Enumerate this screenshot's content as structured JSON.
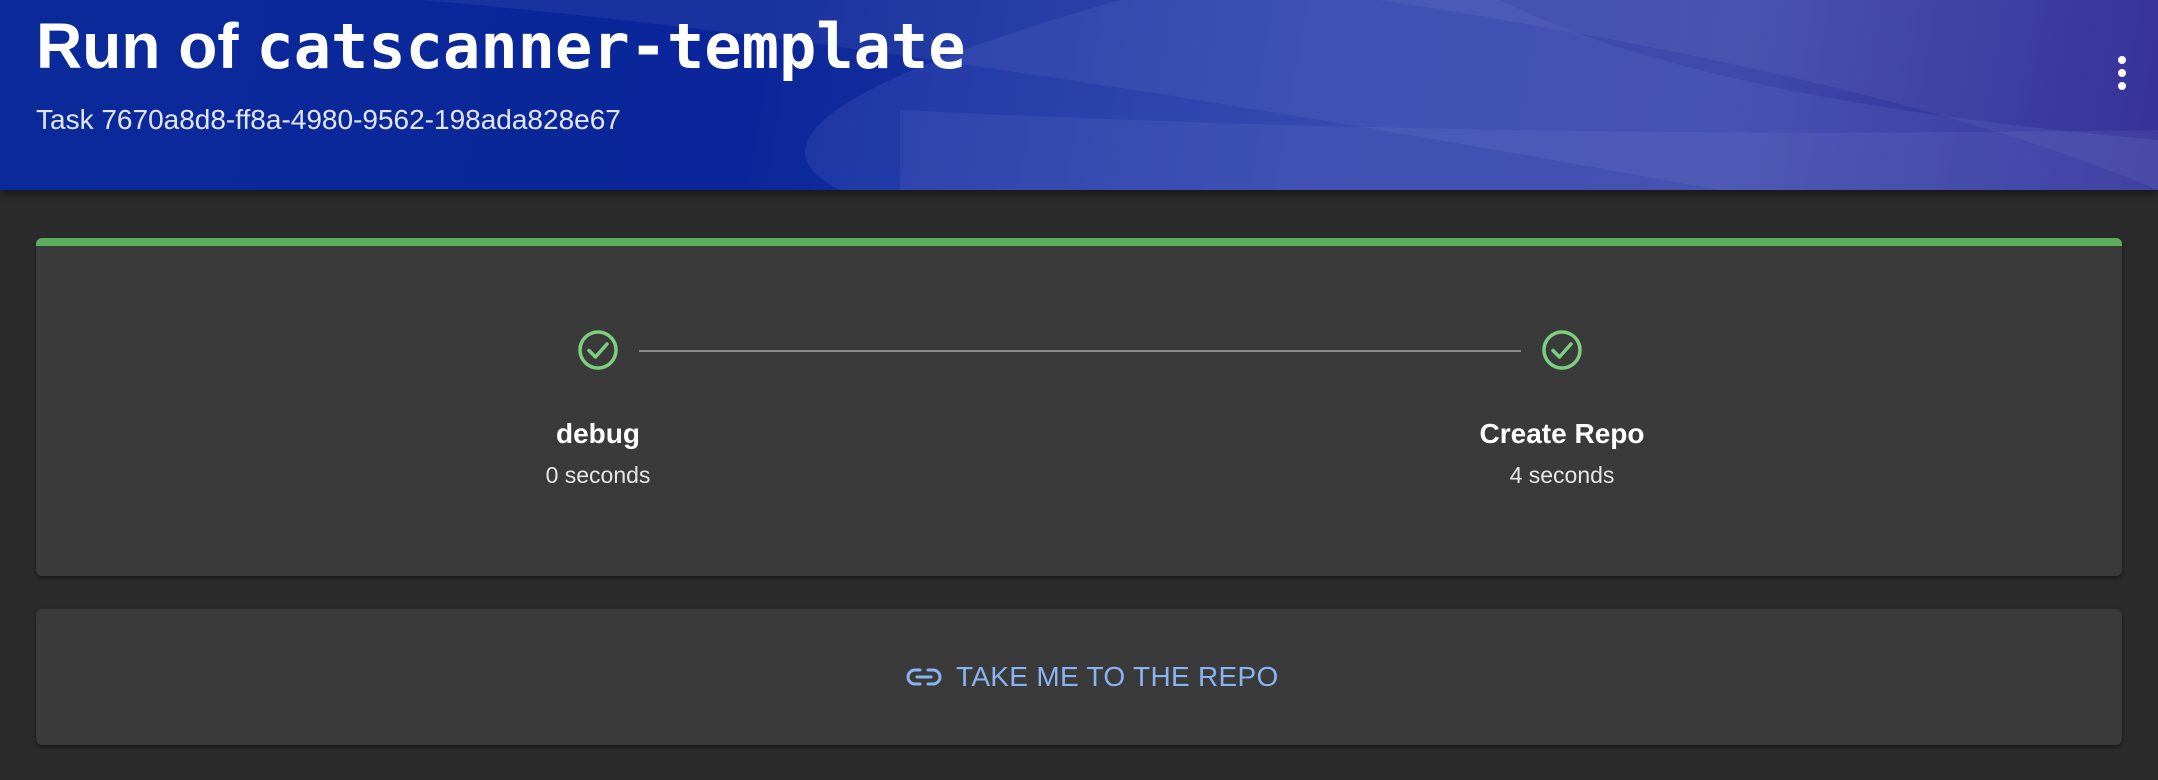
{
  "header": {
    "title_prefix": "Run of ",
    "title_template": "catscanner-template",
    "subtitle": "Task 7670a8d8-ff8a-4980-9562-198ada828e67",
    "menu_icon": "more-vert-icon"
  },
  "steps": [
    {
      "name": "debug",
      "duration": "0 seconds",
      "status": "completed"
    },
    {
      "name": "Create Repo",
      "duration": "4 seconds",
      "status": "completed"
    }
  ],
  "repo_link": {
    "label": "TAKE ME TO THE REPO",
    "icon": "link-icon"
  },
  "colors": {
    "success": "#5cad5e",
    "check": "#7ccf7f",
    "link": "#8ab4f0",
    "header_blue": "#0b2a9a",
    "card_bg": "#3a3a3a",
    "page_bg": "#2b2b2b"
  }
}
